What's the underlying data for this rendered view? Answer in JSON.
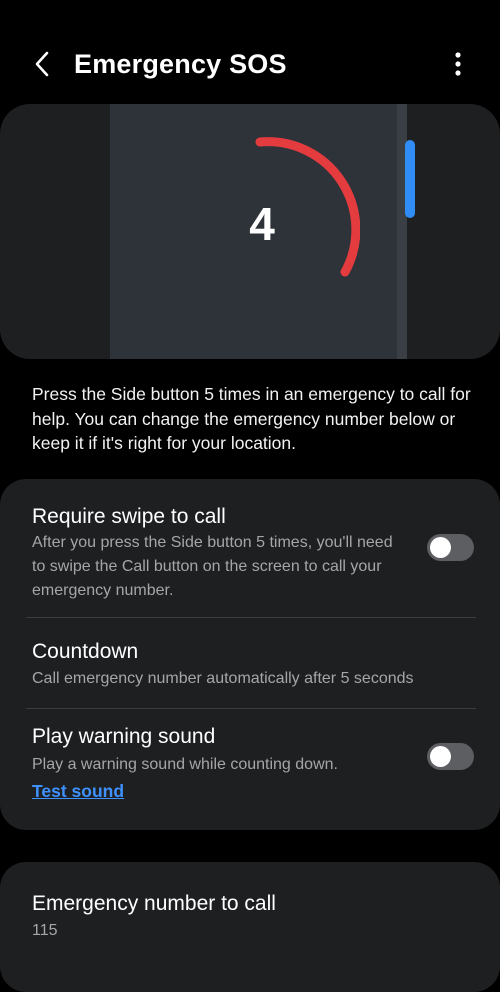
{
  "header": {
    "title": "Emergency SOS",
    "back_icon": "back-chevron-icon",
    "more_icon": "more-vertical-icon"
  },
  "illustration": {
    "countdown_number": "4",
    "arc_color": "#e43b3f",
    "side_button_color": "#2f8df5"
  },
  "description": "Press the Side button 5 times in an emergency to call for help. You can change the emergency number below or keep it if it's right for your location.",
  "settings": {
    "require_swipe": {
      "title": "Require swipe to call",
      "subtitle": "After you press the Side button 5 times, you'll need to swipe the Call button on the screen to call your emergency number.",
      "enabled": false
    },
    "countdown": {
      "title": "Countdown",
      "subtitle": "Call emergency number automatically after 5 seconds"
    },
    "warning_sound": {
      "title": "Play warning sound",
      "subtitle": "Play a warning sound while counting down.",
      "link": "Test sound",
      "enabled": false
    }
  },
  "emergency_number": {
    "title": "Emergency number to call",
    "value": "115"
  },
  "colors": {
    "background": "#000000",
    "card": "#1e1f21",
    "link": "#3e91ff",
    "toggle_off": "#5d5e61"
  }
}
